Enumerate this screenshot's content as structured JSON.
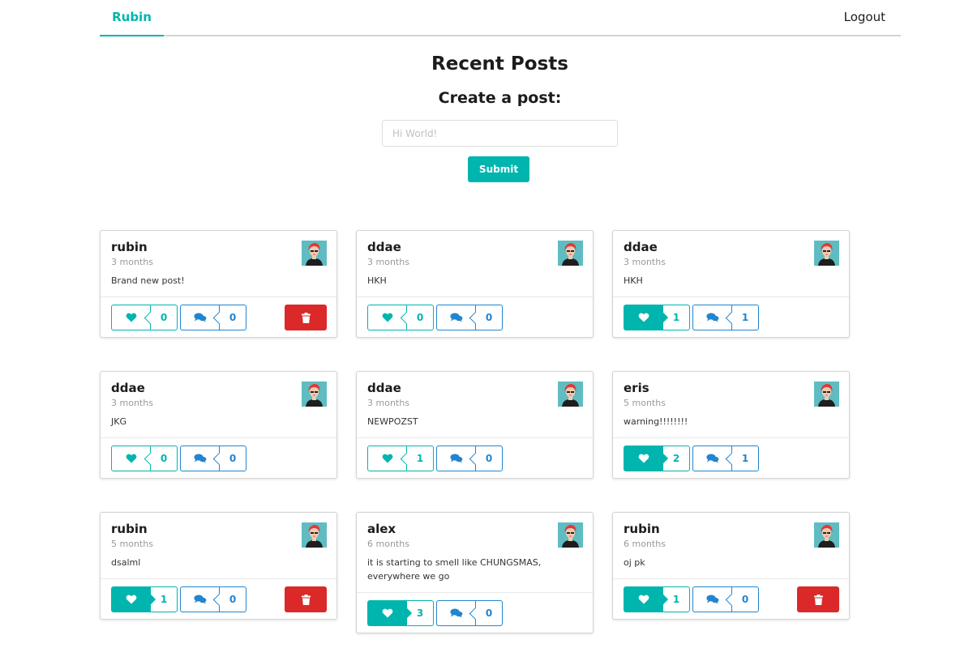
{
  "nav": {
    "brand": "Rubin",
    "logout": "Logout"
  },
  "header": {
    "title": "Recent Posts",
    "create_title": "Create a post:",
    "input_placeholder": "Hi World!",
    "submit_label": "Submit"
  },
  "posts": [
    {
      "author": "rubin",
      "time": "3 months",
      "text": "Brand new post!",
      "likes": "0",
      "comments": "0",
      "liked": false,
      "deletable": true
    },
    {
      "author": "ddae",
      "time": "3 months",
      "text": "HKH",
      "likes": "0",
      "comments": "0",
      "liked": false,
      "deletable": false
    },
    {
      "author": "ddae",
      "time": "3 months",
      "text": "HKH",
      "likes": "1",
      "comments": "1",
      "liked": true,
      "deletable": false
    },
    {
      "author": "ddae",
      "time": "3 months",
      "text": "JKG",
      "likes": "0",
      "comments": "0",
      "liked": false,
      "deletable": false
    },
    {
      "author": "ddae",
      "time": "3 months",
      "text": "NEWPOZST",
      "likes": "1",
      "comments": "0",
      "liked": false,
      "deletable": false
    },
    {
      "author": "eris",
      "time": "5 months",
      "text": "warning!!!!!!!!",
      "likes": "2",
      "comments": "1",
      "liked": true,
      "deletable": false
    },
    {
      "author": "rubin",
      "time": "5 months",
      "text": "dsalml",
      "likes": "1",
      "comments": "0",
      "liked": true,
      "deletable": true
    },
    {
      "author": "alex",
      "time": "6 months",
      "text": "it is starting to smell like CHUNGSMAS, everywhere we go",
      "likes": "3",
      "comments": "0",
      "liked": true,
      "deletable": false
    },
    {
      "author": "rubin",
      "time": "6 months",
      "text": "oj pk",
      "likes": "1",
      "comments": "0",
      "liked": true,
      "deletable": true
    }
  ],
  "colors": {
    "accent": "#00b5ad",
    "comment": "#2185d0",
    "danger": "#db2828"
  },
  "icons": {
    "like": "heart-icon",
    "comment": "comments-icon",
    "delete": "trash-icon"
  }
}
